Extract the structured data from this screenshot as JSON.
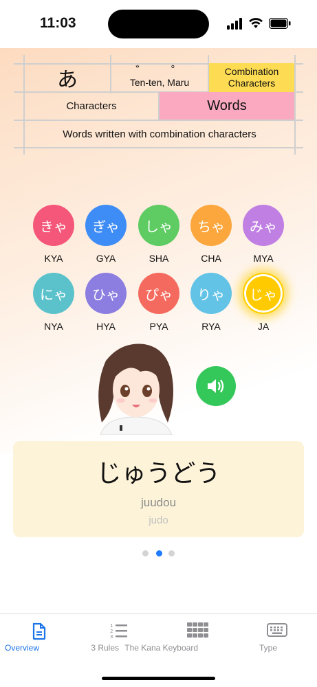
{
  "status_bar": {
    "time": "11:03"
  },
  "header_grid": {
    "hiragana": "あ",
    "tenten_marks": "゛ ゜",
    "tenten_label": "Ten-ten, Maru",
    "combination": "Combination Characters",
    "characters": "Characters",
    "words": "Words",
    "description": "Words written with combination characters",
    "colors": {
      "combination": "#fddb52",
      "words": "#fba9c1"
    }
  },
  "kana": [
    {
      "kana": "きゃ",
      "romaji": "KYA",
      "color": "#f5577a"
    },
    {
      "kana": "ぎゃ",
      "romaji": "GYA",
      "color": "#3e8cf5"
    },
    {
      "kana": "しゃ",
      "romaji": "SHA",
      "color": "#5ecb63"
    },
    {
      "kana": "ちゃ",
      "romaji": "CHA",
      "color": "#fba73d"
    },
    {
      "kana": "みゃ",
      "romaji": "MYA",
      "color": "#c07fe3"
    },
    {
      "kana": "にゃ",
      "romaji": "NYA",
      "color": "#5bc2cb"
    },
    {
      "kana": "ひゃ",
      "romaji": "HYA",
      "color": "#8b7ee0"
    },
    {
      "kana": "ぴゃ",
      "romaji": "PYA",
      "color": "#f56a5e"
    },
    {
      "kana": "りゃ",
      "romaji": "RYA",
      "color": "#62c3e6"
    },
    {
      "kana": "じゃ",
      "romaji": "JA",
      "color": "#ffcb00",
      "selected": true
    }
  ],
  "word_card": {
    "japanese": "じゅうどう",
    "romaji": "juudou",
    "english": "judo"
  },
  "pager": {
    "count": 3,
    "active": 2
  },
  "tabs": [
    {
      "label": "Overview",
      "icon": "document-icon",
      "active": true
    },
    {
      "label": "3 Rules",
      "icon": "numbered-list-icon"
    },
    {
      "label": "The Kana Keyboard",
      "icon": "grid-keypad-icon"
    },
    {
      "label": "Type",
      "icon": "keyboard-icon"
    }
  ],
  "colors": {
    "accent": "#1a73e8",
    "speaker": "#34c759",
    "card_bg": "#fdf3d9"
  }
}
